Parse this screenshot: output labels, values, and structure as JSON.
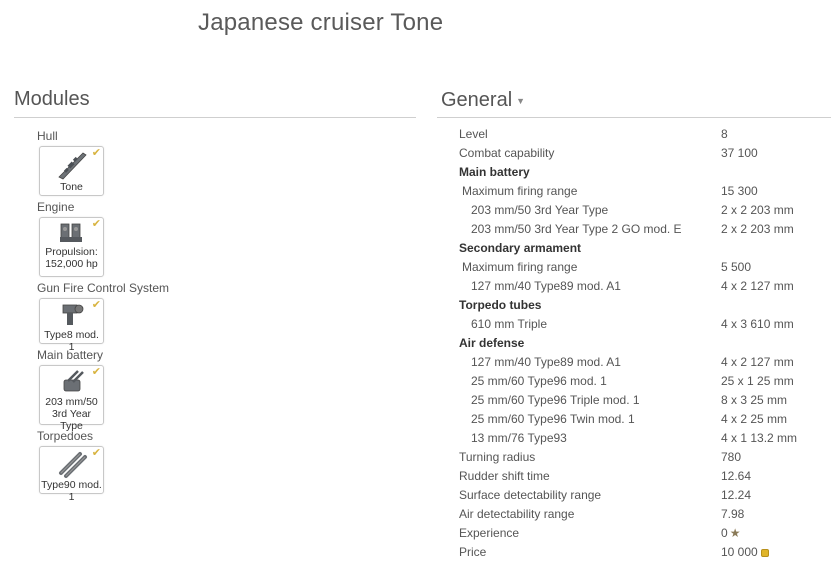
{
  "title": "Japanese cruiser Tone",
  "modules": {
    "heading": "Modules",
    "groups": [
      {
        "label": "Hull",
        "card": "Tone",
        "icon": "hull-icon"
      },
      {
        "label": "Engine",
        "card": "Propulsion: 152,000 hp",
        "icon": "engine-icon"
      },
      {
        "label": "Gun Fire Control System",
        "card": "Type8 mod. 1",
        "icon": "fire-control-icon"
      },
      {
        "label": "Main battery",
        "card": "203 mm/50 3rd Year Type",
        "icon": "main-battery-icon"
      },
      {
        "label": "Torpedoes",
        "card": "Type90 mod. 1",
        "icon": "torpedo-icon"
      }
    ]
  },
  "general": {
    "heading": "General",
    "rows": [
      {
        "label": "Level",
        "value": "8"
      },
      {
        "label": "Combat capability",
        "value": "37 100"
      },
      {
        "label": "Main battery",
        "value": ""
      },
      {
        "label": "Maximum firing range",
        "value": "15 300"
      },
      {
        "label": "203 mm/50 3rd Year Type",
        "value": "2 x 2 203 mm"
      },
      {
        "label": "203 mm/50 3rd Year Type 2 GO mod. E",
        "value": "2 x 2 203 mm"
      },
      {
        "label": "Secondary armament",
        "value": ""
      },
      {
        "label": "Maximum firing range",
        "value": "5 500"
      },
      {
        "label": "127 mm/40 Type89 mod. A1",
        "value": "4 x 2 127 mm"
      },
      {
        "label": "Torpedo tubes",
        "value": ""
      },
      {
        "label": "610 mm Triple",
        "value": "4 x 3 610 mm"
      },
      {
        "label": "Air defense",
        "value": ""
      },
      {
        "label": "127 mm/40 Type89 mod. A1",
        "value": "4 x 2 127 mm"
      },
      {
        "label": "25 mm/60 Type96 mod. 1",
        "value": "25 x 1 25 mm"
      },
      {
        "label": "25 mm/60 Type96 Triple mod. 1",
        "value": "8 x 3 25 mm"
      },
      {
        "label": "25 mm/60 Type96 Twin mod. 1",
        "value": "4 x 2 25 mm"
      },
      {
        "label": "13 mm/76 Type93",
        "value": "4 x 1 13.2 mm"
      },
      {
        "label": "Turning radius",
        "value": "780"
      },
      {
        "label": "Rudder shift time",
        "value": "12.64"
      },
      {
        "label": "Surface detectability range",
        "value": "12.24"
      },
      {
        "label": "Air detectability range",
        "value": "7.98"
      },
      {
        "label": "Experience",
        "value": "0"
      },
      {
        "label": "Price",
        "value": "10 000"
      }
    ]
  },
  "colors": {
    "check": "#d8b440",
    "coin": "#e0b52a",
    "rule": "#cfcfcf"
  }
}
